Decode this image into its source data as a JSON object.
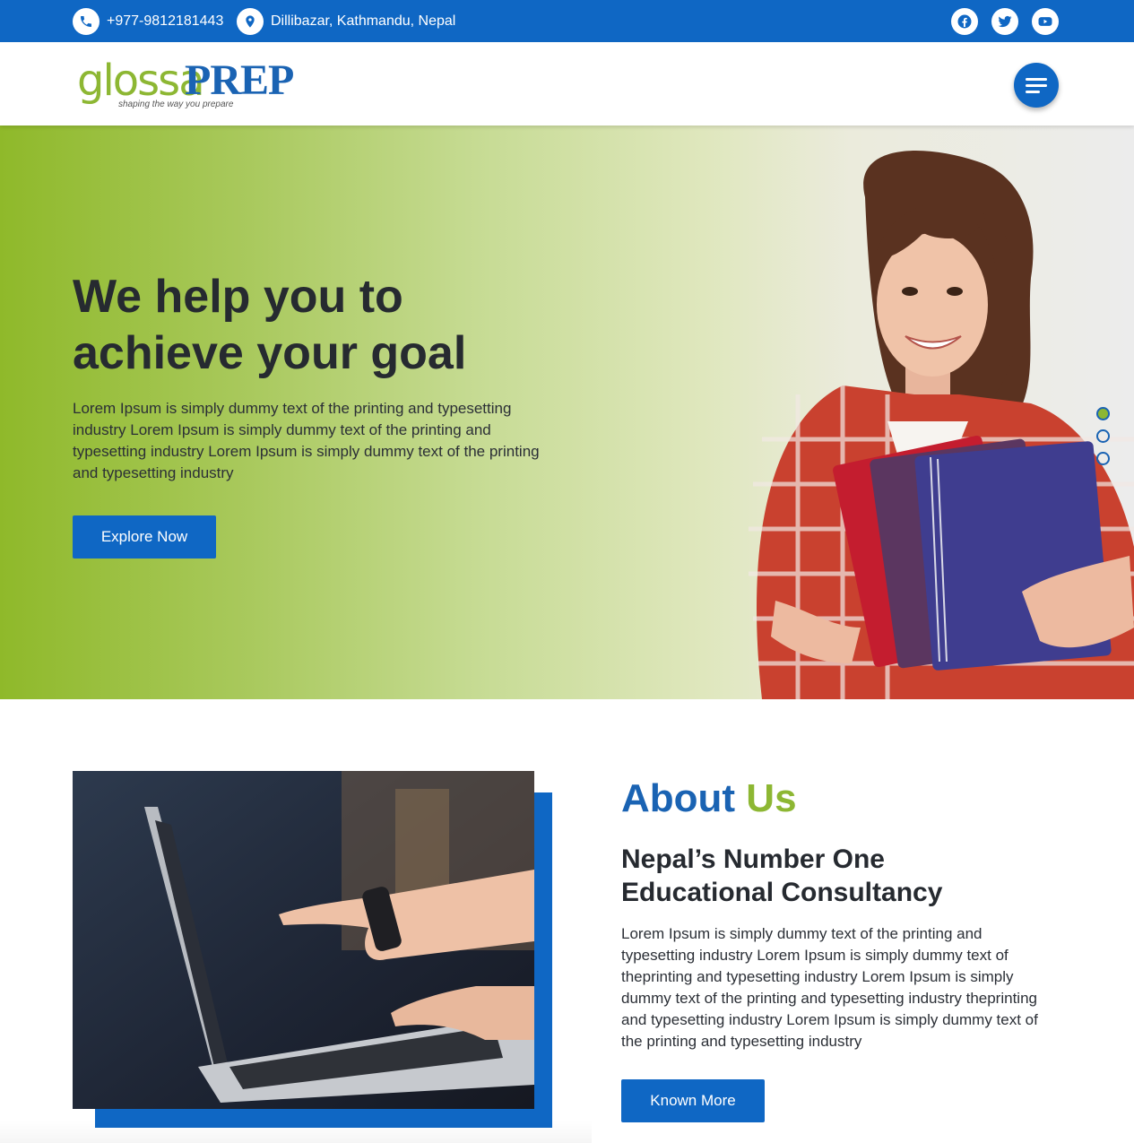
{
  "topbar": {
    "phone": "+977-9812181443",
    "address": "Dillibazar, Kathmandu, Nepal",
    "phone_icon": "phone-icon",
    "location_icon": "location-pin-icon",
    "social": [
      "facebook-icon",
      "twitter-icon",
      "youtube-icon"
    ]
  },
  "header": {
    "logo_part1": "glossa",
    "logo_part2": "PREP",
    "logo_tagline": "shaping the way you prepare",
    "menu_icon": "hamburger-menu-icon"
  },
  "hero": {
    "title": "We help you to achieve your goal",
    "text": "Lorem Ipsum is simply dummy text of the printing and typesetting industry Lorem Ipsum is simply dummy text of the printing and typesetting industry Lorem Ipsum is simply dummy text of the printing and typesetting industry",
    "button": "Explore Now",
    "slides_total": 3,
    "active_slide": 1
  },
  "about": {
    "title_part1": "About",
    "title_part2": "Us",
    "subtitle": "Nepal’s Number One Educational Consultancy",
    "text": "Lorem Ipsum is simply dummy text of the printing and typesetting industry Lorem Ipsum is simply dummy text of theprinting and typesetting industry Lorem Ipsum is simply dummy text of the printing and typesetting industry theprinting and typesetting industry Lorem Ipsum is simply dummy text of the printing and typesetting industry",
    "button": "Known More"
  },
  "colors": {
    "brand_blue": "#0f67c4",
    "brand_green": "#8db733",
    "text_dark": "#262a30"
  }
}
